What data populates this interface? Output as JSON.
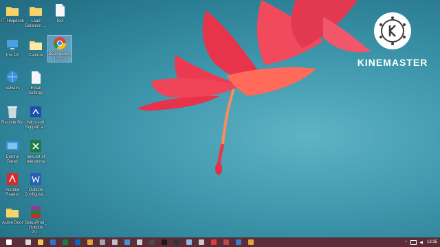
{
  "desktop": {
    "icons": [
      {
        "label": "IT_Helpdesk",
        "icon": "folder-icon"
      },
      {
        "label": "Load Balancer ...",
        "icon": "folder-icon"
      },
      {
        "label": "Test",
        "icon": "document-icon"
      },
      {
        "label": "This PC",
        "icon": "computer-icon"
      },
      {
        "label": "Capture",
        "icon": "folder-icon"
      },
      {
        "label": "Bookmarks_1 1_22",
        "icon": "chrome-icon"
      },
      {
        "label": "Network",
        "icon": "network-icon"
      },
      {
        "label": "Email Settings",
        "icon": "document-icon"
      },
      {
        "label": "Recycle Bin",
        "icon": "recycle-bin-icon"
      },
      {
        "label": "Microsoft Support a...",
        "icon": "microsoft-support-icon"
      },
      {
        "label": "Control Panel",
        "icon": "control-panel-icon"
      },
      {
        "label": "new list of telephone",
        "icon": "excel-icon"
      },
      {
        "label": "Acrobat Reader",
        "icon": "acrobat-icon"
      },
      {
        "label": "Outlook Configurat...",
        "icon": "word-icon"
      },
      {
        "label": "Active Boot",
        "icon": "folder-icon"
      },
      {
        "label": "SetupProd_ Outlook 20...",
        "icon": "winrar-icon"
      }
    ]
  },
  "watermark": {
    "text": "KINEMASTER"
  },
  "taskbar": {
    "buttons": [
      {
        "icon": "start-icon",
        "color": "#ffffff"
      },
      {
        "icon": "task-view-icon",
        "color": "#d9d9d9"
      },
      {
        "icon": "file-explorer-icon",
        "color": "#f2c94c"
      },
      {
        "icon": "powershell-icon",
        "color": "#2f6fd6"
      },
      {
        "icon": "excel-icon",
        "color": "#1e7b45"
      },
      {
        "icon": "outlook-icon",
        "color": "#0a64c4"
      },
      {
        "icon": "chrome-icon",
        "color": "#e9a23b"
      },
      {
        "icon": "app-icon",
        "color": "#9aa7b5"
      },
      {
        "icon": "browser-icon",
        "color": "#c2c2c2"
      },
      {
        "icon": "remote-desktop-icon",
        "color": "#4a90d9"
      },
      {
        "icon": "app-icon",
        "color": "#d0d0d0"
      },
      {
        "icon": "app-icon",
        "color": "#4a4a4a"
      },
      {
        "icon": "terminal-icon",
        "color": "#1a1a1a"
      },
      {
        "icon": "app-icon",
        "color": "#333333"
      },
      {
        "icon": "notepad-icon",
        "color": "#8fb8e0"
      },
      {
        "icon": "app-icon",
        "color": "#cccccc"
      },
      {
        "icon": "record-icon",
        "color": "#e03a3a"
      },
      {
        "icon": "app-icon",
        "color": "#b94b4b"
      },
      {
        "icon": "edge-icon",
        "color": "#3a7bd5"
      },
      {
        "icon": "chrome-icon",
        "color": "#e9a23b"
      }
    ],
    "clock": "13:35"
  }
}
